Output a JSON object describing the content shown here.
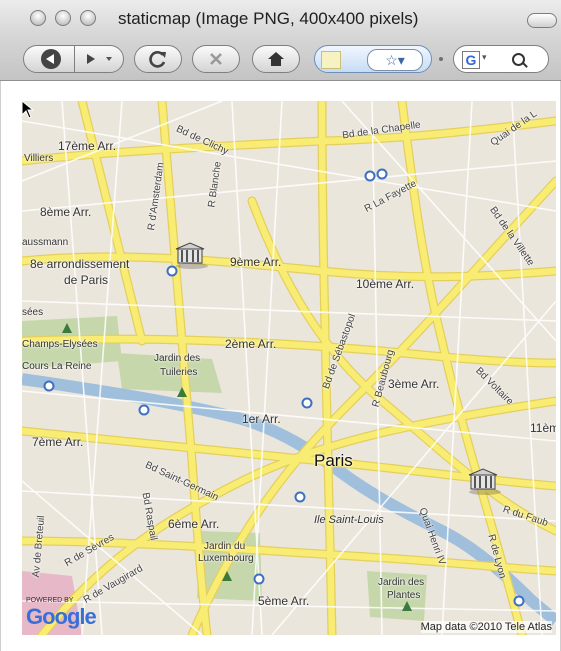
{
  "window": {
    "title": "staticmap (Image PNG, 400x400 pixels)"
  },
  "toolbar": {
    "back_icon": "back-arrow-icon",
    "forward_icon": "forward-arrow-icon",
    "reload_icon": "reload-icon",
    "stop_icon": "stop-icon",
    "home_icon": "home-icon",
    "bookmark_glyph": "☆▾",
    "search_engine_glyph": "G",
    "search_dropdown_glyph": "▾"
  },
  "map": {
    "labels": {
      "arr17": "17ème Arr.",
      "villiers": "Villiers",
      "bd_clichy": "Bd de Clichy",
      "bd_chapelle": "Bd de la Chapelle",
      "quai_loire": "Quai de la L",
      "arr8": "8ème Arr.",
      "amsterdam": "R d'Amsterdam",
      "blanche": "R Blanche",
      "lafayette": "R La Fayette",
      "villette": "Bd de la Villette",
      "haussmann": "aussmann",
      "arr8_full_1": "8e arrondissement",
      "arr8_full_2": "de Paris",
      "arr9": "9ème Arr.",
      "arr10": "10ème Arr.",
      "elysees": "Champs-Elysées",
      "arr2": "2ème Arr.",
      "sebastopol": "Bd de Sébastopol",
      "reine": "Cours La Reine",
      "tuileries_1": "Jardin des",
      "tuileries_2": "Tuileries",
      "beaubourg": "R Beaubourg",
      "arr3": "3ème Arr.",
      "voltaire": "Bd Voltaire",
      "arr1": "1er Arr.",
      "arr11": "11èm",
      "arr7": "7ème Arr.",
      "paris": "Paris",
      "st_germain": "Bd Saint-Germain",
      "raspail": "Bd Raspail",
      "arr6": "6ème Arr.",
      "ile": "Ile Saint-Louis",
      "henri": "Quai Henri IV",
      "faubourg": "R du Faub",
      "breteuil": "Av de Breteuil",
      "sevres": "R de Sèvres",
      "luxembourg_1": "Jardin du",
      "luxembourg_2": "Luxembourg",
      "vaugirard": "R de Vaugirard",
      "lyon": "R de Lyon",
      "arr5": "5ème Arr.",
      "plantes_1": "Jardin des",
      "plantes_2": "Plantes",
      "elysees_top": "sées"
    },
    "google_powered": "POWERED BY",
    "google_word": "Google",
    "copyright": "Map data ©2010 Tele Atlas",
    "colors": {
      "road": "#f8ec73",
      "road_edge": "#e4cf5e",
      "land": "#ebe6dc",
      "park": "#c6d7ac",
      "water": "#9fbfdc",
      "metro": "#3f6fc1"
    }
  }
}
